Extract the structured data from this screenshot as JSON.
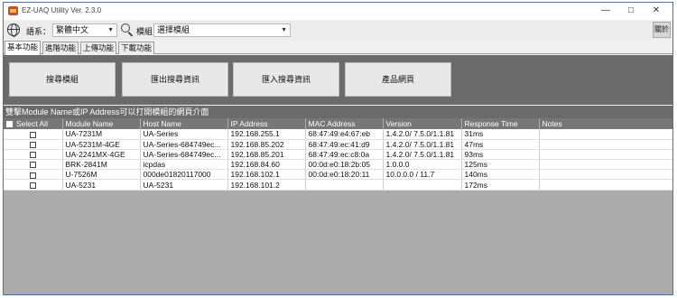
{
  "window": {
    "title": "EZ-UAQ Utility Ver. 2.3.0",
    "controls": [
      "—",
      "□",
      "✕"
    ]
  },
  "toolbar": {
    "language_label": "語系：",
    "language_value": "繁體中文",
    "module_label": "模組",
    "module_value": "選擇模組",
    "close_label": "關於"
  },
  "tabs": [
    {
      "label": "基本功能",
      "active": true
    },
    {
      "label": "進階功能",
      "active": false
    },
    {
      "label": "上傳功能",
      "active": false
    },
    {
      "label": "下載功能",
      "active": false
    }
  ],
  "actions": [
    {
      "label": "搜尋模組"
    },
    {
      "label": "匯出搜尋資訊"
    },
    {
      "label": "匯入搜尋資訊"
    },
    {
      "label": "產品網頁"
    }
  ],
  "info_text": "雙擊Module Name或IP Address可以打開模組的網頁介面",
  "table": {
    "columns": [
      "Select All",
      "Module Name",
      "Host Name",
      "IP Address",
      "MAC Address",
      "Version",
      "Response Time",
      "Notes"
    ],
    "rows": [
      {
        "module": "UA-7231M",
        "host": "UA-Series",
        "ip": "192.168.255.1",
        "mac": "68:47:49:e4:67:eb",
        "version": "1.4.2.0/ 7.5.0/1.1.81",
        "response": "31ms",
        "notes": ""
      },
      {
        "module": "UA-5231M-4GE",
        "host": "UA-Series-684749ec...",
        "ip": "192.168.85.202",
        "mac": "68:47:49:ec:41:d9",
        "version": "1.4.2.0/ 7.5.0/1.1.81",
        "response": "47ms",
        "notes": ""
      },
      {
        "module": "UA-2241MX-4GE",
        "host": "UA-Series-684749ec...",
        "ip": "192.168.85.201",
        "mac": "68:47:49:ec:c8:0a",
        "version": "1.4.2.0/ 7.5.0/1.1.81",
        "response": "93ms",
        "notes": ""
      },
      {
        "module": "BRK-2841M",
        "host": "icpdas",
        "ip": "192.168.84.60",
        "mac": "00:0d:e0:18:2b:05",
        "version": "1.0.0.0",
        "response": "125ms",
        "notes": ""
      },
      {
        "module": "U-7526M",
        "host": "000de01820117000",
        "ip": "192.168.102.1",
        "mac": "00:0d:e0:18:20:11",
        "version": "10.0.0.0 / 11.7",
        "response": "140ms",
        "notes": ""
      },
      {
        "module": "UA-5231",
        "host": "UA-5231",
        "ip": "192.168.101.2",
        "mac": "",
        "version": "",
        "response": "172ms",
        "notes": ""
      }
    ]
  }
}
